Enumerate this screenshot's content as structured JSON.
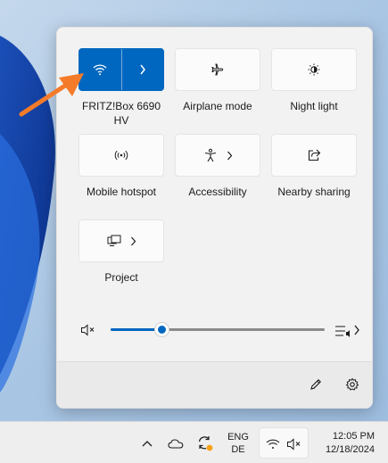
{
  "quick_settings": {
    "tiles": [
      {
        "label": "FRITZ!Box 6690 HV",
        "icon": "wifi-icon",
        "active": true,
        "expandable": true
      },
      {
        "label": "Airplane mode",
        "icon": "airplane-icon",
        "active": false
      },
      {
        "label": "Night light",
        "icon": "brightness-icon",
        "active": false
      },
      {
        "label": "Mobile hotspot",
        "icon": "hotspot-icon",
        "active": false
      },
      {
        "label": "Accessibility",
        "icon": "accessibility-icon",
        "active": false,
        "expandable": true
      },
      {
        "label": "Nearby sharing",
        "icon": "share-icon",
        "active": false
      },
      {
        "label": "Project",
        "icon": "project-icon",
        "active": false,
        "expandable": true
      }
    ],
    "volume": {
      "muted": true,
      "level": 0.24
    },
    "footer": {
      "edit_icon": "pencil-icon",
      "settings_icon": "gear-icon"
    }
  },
  "taskbar": {
    "language_line1": "ENG",
    "language_line2": "DE",
    "time": "12:05 PM",
    "date": "12/18/2024"
  },
  "colors": {
    "accent": "#0067c0",
    "annotation_arrow": "#f47b2a"
  }
}
